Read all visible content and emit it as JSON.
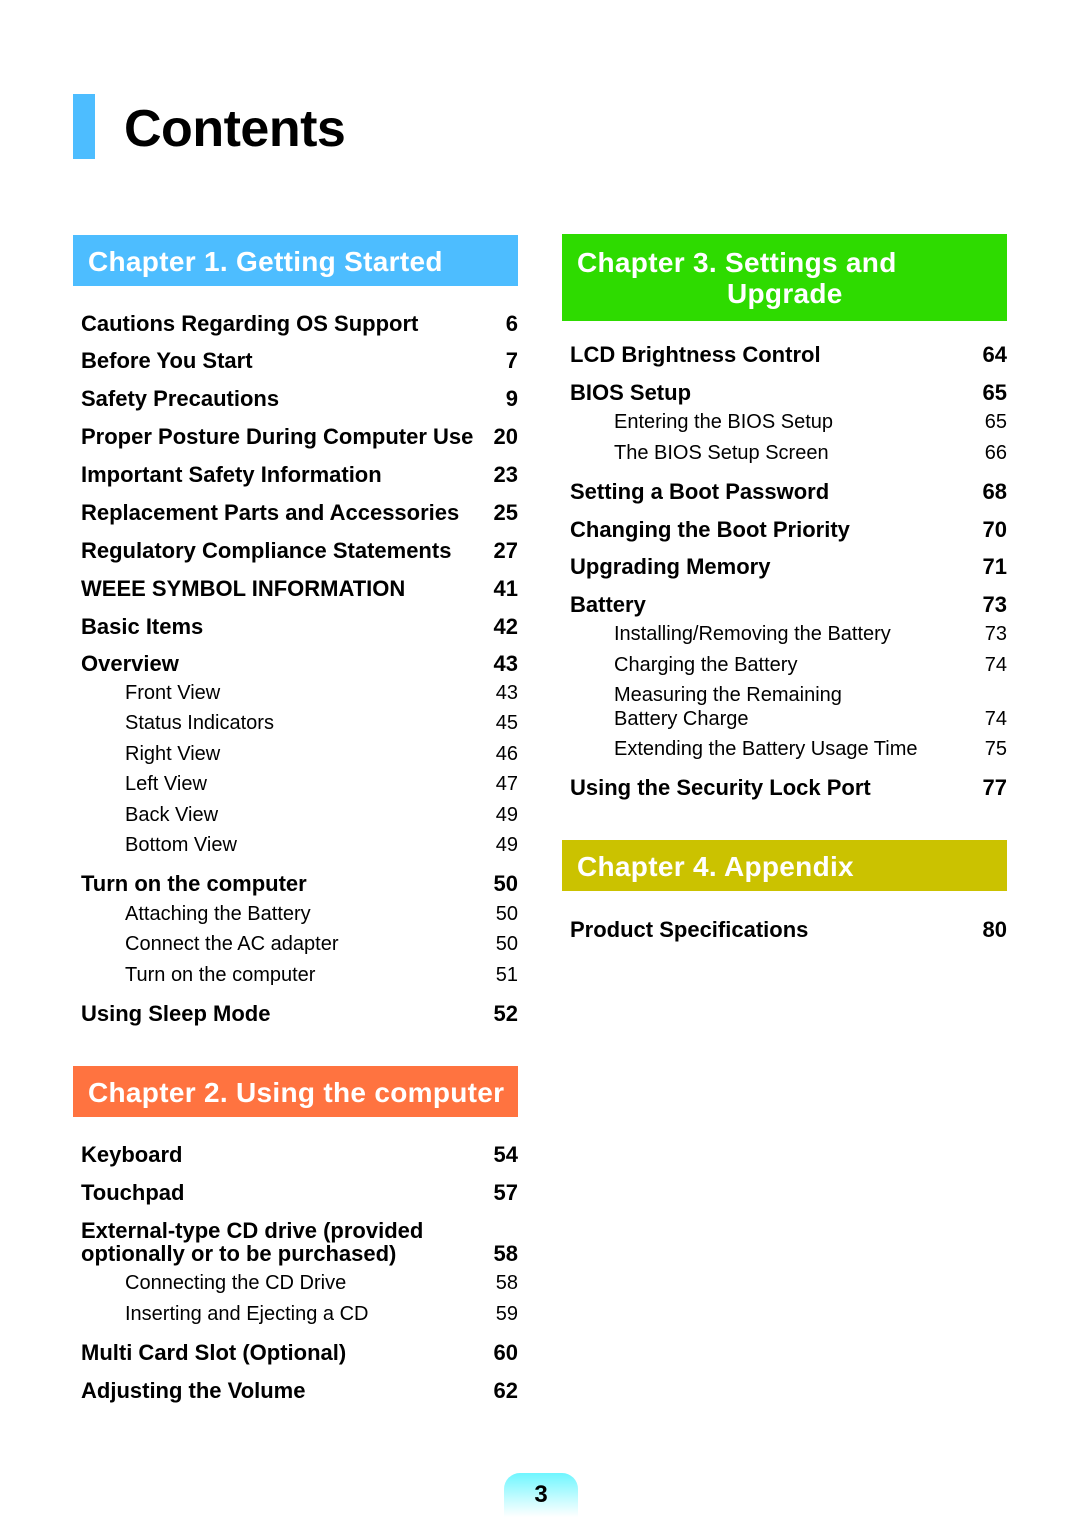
{
  "page": {
    "title": "Contents",
    "page_number": "3",
    "colors": {
      "title_accent": "#4dbdff",
      "chapter1": "#4dbdff",
      "chapter2": "#ff7340",
      "chapter3": "#2edb00",
      "chapter4": "#cbc200",
      "page_badge": "#6ff6ff"
    }
  },
  "chapters": [
    {
      "title": "Chapter 1. Getting Started",
      "entries": [
        {
          "label": "Cautions Regarding OS Support",
          "page": "6",
          "level": "main"
        },
        {
          "label": "Before You Start",
          "page": "7",
          "level": "main"
        },
        {
          "label": "Safety Precautions",
          "page": "9",
          "level": "main"
        },
        {
          "label": "Proper Posture During Computer Use",
          "page": "20",
          "level": "main"
        },
        {
          "label": "Important Safety Information",
          "page": "23",
          "level": "main"
        },
        {
          "label": "Replacement Parts and Accessories",
          "page": "25",
          "level": "main"
        },
        {
          "label": "Regulatory Compliance Statements",
          "page": "27",
          "level": "main"
        },
        {
          "label": "WEEE SYMBOL INFORMATION",
          "page": "41",
          "level": "main"
        },
        {
          "label": "Basic Items",
          "page": "42",
          "level": "main"
        },
        {
          "label": "Overview",
          "page": "43",
          "level": "main"
        },
        {
          "label": "Front View",
          "page": "43",
          "level": "sub"
        },
        {
          "label": "Status Indicators",
          "page": "45",
          "level": "sub"
        },
        {
          "label": "Right View",
          "page": "46",
          "level": "sub"
        },
        {
          "label": "Left View",
          "page": "47",
          "level": "sub"
        },
        {
          "label": "Back View",
          "page": "49",
          "level": "sub"
        },
        {
          "label": "Bottom View",
          "page": "49",
          "level": "sub"
        },
        {
          "label": "Turn on the computer",
          "page": "50",
          "level": "main"
        },
        {
          "label": "Attaching the Battery",
          "page": "50",
          "level": "sub"
        },
        {
          "label": "Connect the AC adapter",
          "page": "50",
          "level": "sub"
        },
        {
          "label": "Turn on the computer",
          "page": "51",
          "level": "sub"
        },
        {
          "label": "Using Sleep Mode",
          "page": "52",
          "level": "main"
        }
      ]
    },
    {
      "title": "Chapter 2. Using the computer",
      "entries": [
        {
          "label": "Keyboard",
          "page": "54",
          "level": "main"
        },
        {
          "label": "Touchpad",
          "page": "57",
          "level": "main"
        },
        {
          "label": "External-type CD drive (provided\noptionally or to be purchased)",
          "page": "58",
          "level": "main"
        },
        {
          "label": "Connecting the CD Drive",
          "page": "58",
          "level": "sub"
        },
        {
          "label": "Inserting and Ejecting a CD",
          "page": "59",
          "level": "sub"
        },
        {
          "label": "Multi Card Slot (Optional)",
          "page": "60",
          "level": "main"
        },
        {
          "label": "Adjusting the Volume",
          "page": "62",
          "level": "main"
        }
      ]
    },
    {
      "title_line1": "Chapter 3. Settings and",
      "title_line2": "Upgrade",
      "entries": [
        {
          "label": "LCD Brightness Control",
          "page": "64",
          "level": "main"
        },
        {
          "label": "BIOS Setup",
          "page": "65",
          "level": "main"
        },
        {
          "label": "Entering the BIOS Setup",
          "page": "65",
          "level": "sub"
        },
        {
          "label": "The BIOS Setup Screen",
          "page": "66",
          "level": "sub"
        },
        {
          "label": "Setting a Boot Password",
          "page": "68",
          "level": "main"
        },
        {
          "label": "Changing the Boot Priority",
          "page": "70",
          "level": "main"
        },
        {
          "label": "Upgrading Memory",
          "page": "71",
          "level": "main"
        },
        {
          "label": "Battery",
          "page": "73",
          "level": "main"
        },
        {
          "label": "Installing/Removing the Battery",
          "page": "73",
          "level": "sub"
        },
        {
          "label": "Charging the Battery",
          "page": "74",
          "level": "sub"
        },
        {
          "label": "Measuring the Remaining\nBattery Charge",
          "page": "74",
          "level": "sub"
        },
        {
          "label": "Extending the Battery Usage Time",
          "page": "75",
          "level": "sub"
        },
        {
          "label": "Using the Security Lock Port",
          "page": "77",
          "level": "main"
        }
      ]
    },
    {
      "title": "Chapter 4. Appendix",
      "entries": [
        {
          "label": "Product Specifications",
          "page": "80",
          "level": "main"
        }
      ]
    }
  ]
}
